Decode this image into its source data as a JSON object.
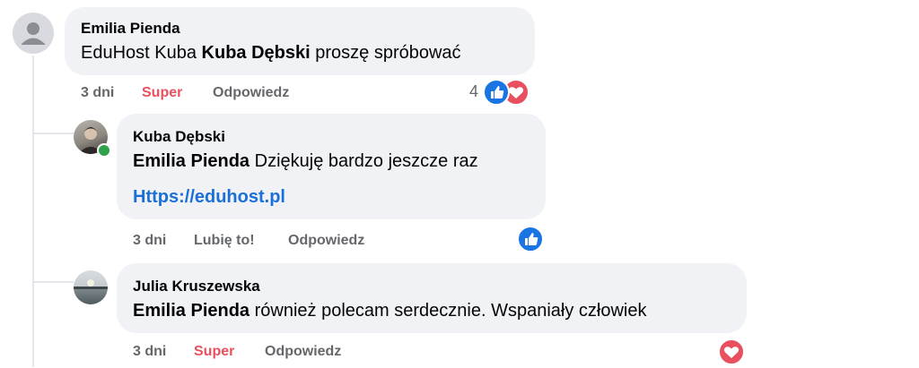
{
  "comments": [
    {
      "author": "Emilia Pienda",
      "text_pre": "EduHost Kuba ",
      "mention": "Kuba Dębski",
      "text_post": " proszę spróbować",
      "time": "3 dni",
      "reaction_label": "Super",
      "reply_label": "Odpowiedz",
      "reaction_count": "4",
      "reaction_icons": [
        "like-icon",
        "love-icon"
      ]
    },
    {
      "author": "Kuba Dębski",
      "mention": "Emilia Pienda",
      "text_post": " Dziękuję bardzo jeszcze raz",
      "link": "Https://eduhost.pl",
      "time": "3 dni",
      "reaction_label": "Lubię to!",
      "reply_label": "Odpowiedz",
      "reaction_icons": [
        "like-icon"
      ]
    },
    {
      "author": "Julia Kruszewska",
      "mention": "Emilia Pienda",
      "text_post": " również polecam serdecznie. Wspaniały człowiek",
      "time": "3 dni",
      "reaction_label": "Super",
      "reply_label": "Odpowiedz",
      "reaction_icons": [
        "love-icon"
      ]
    }
  ],
  "colors": {
    "bubble": "#f0f2f5",
    "like": "#1b74e4",
    "love": "#e9505f",
    "link": "#1a6fd8",
    "online": "#31a24c"
  }
}
